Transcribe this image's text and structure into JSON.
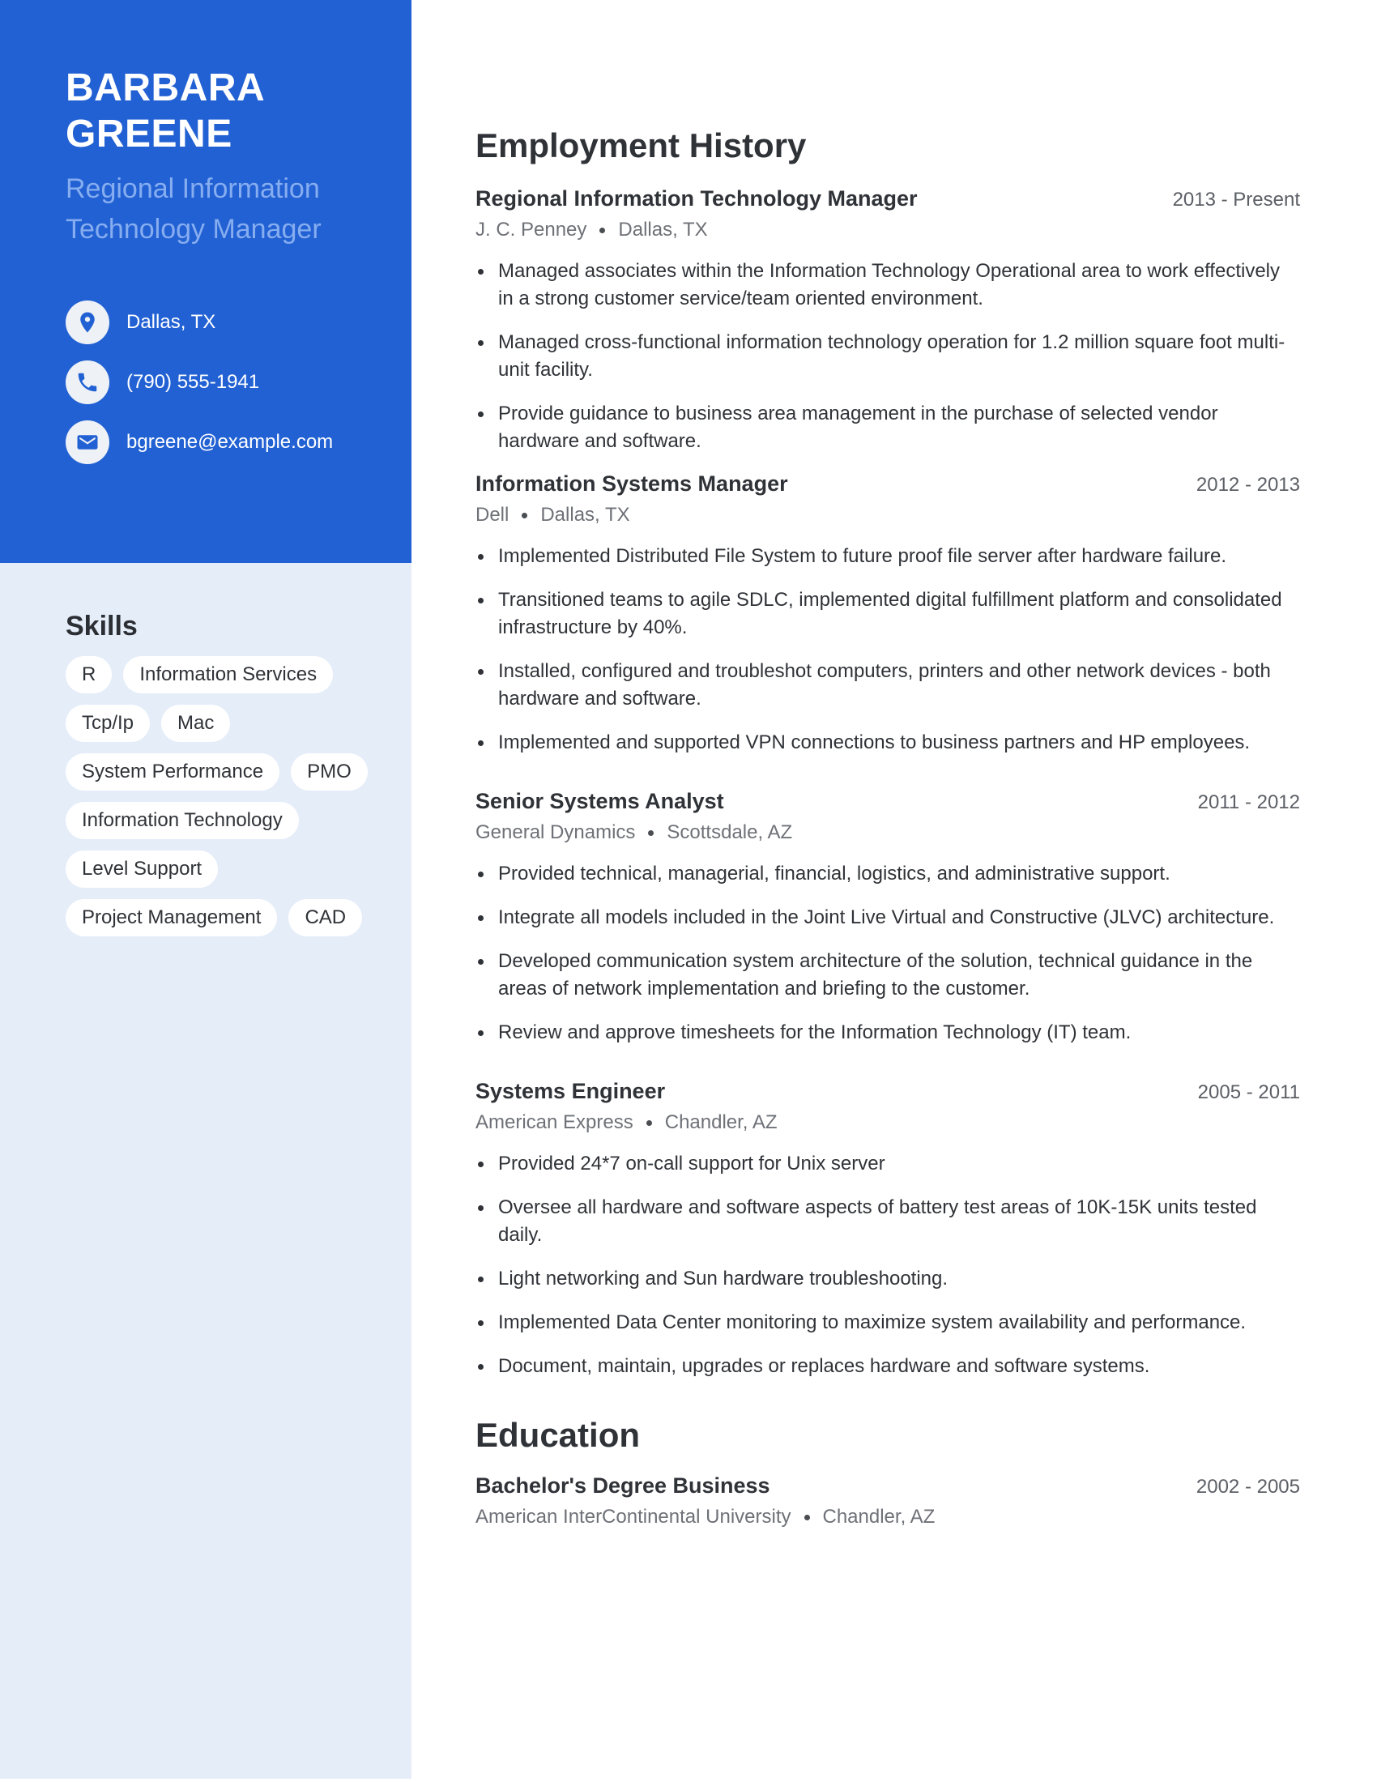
{
  "profile": {
    "name_line1": "BARBARA",
    "name_line2": "GREENE",
    "title_line1": "Regional Information",
    "title_line2": "Technology Manager"
  },
  "contacts": [
    {
      "icon": "location-pin-icon",
      "text": "Dallas, TX"
    },
    {
      "icon": "phone-icon",
      "text": "(790) 555-1941"
    },
    {
      "icon": "email-icon",
      "text": "bgreene@example.com"
    }
  ],
  "skills": {
    "title": "Skills",
    "items": [
      "R",
      "Information Services",
      "Tcp/Ip",
      "Mac",
      "System Performance",
      "PMO",
      "Information Technology",
      "Level Support",
      "Project Management",
      "CAD"
    ]
  },
  "employment": {
    "title": "Employment History",
    "jobs": [
      {
        "title": "Regional Information Technology Manager",
        "dates": "2013 - Present",
        "company": "J. C. Penney",
        "location": "Dallas, TX",
        "bullets": [
          "Managed associates within the Information Technology Operational area to work effectively in a strong customer service/team oriented environment.",
          "Managed cross-functional information technology operation for 1.2 million square foot multi-unit facility.",
          "Provide guidance to business area management in the purchase of selected vendor hardware and software."
        ]
      },
      {
        "title": "Information Systems Manager",
        "dates": "2012 - 2013",
        "company": "Dell",
        "location": "Dallas, TX",
        "bullets": [
          "Implemented Distributed File System to future proof file server after hardware failure.",
          "Transitioned teams to agile SDLC, implemented digital fulfillment platform and consolidated infrastructure by 40%.",
          "Installed, configured and troubleshot computers, printers and other network devices - both hardware and software.",
          "Implemented and supported VPN connections to business partners and HP employees."
        ]
      },
      {
        "title": "Senior Systems Analyst",
        "dates": "2011 - 2012",
        "company": "General Dynamics",
        "location": "Scottsdale, AZ",
        "bullets": [
          "Provided technical, managerial, financial, logistics, and administrative support.",
          "Integrate all models included in the Joint Live Virtual and Constructive (JLVC) architecture.",
          "Developed communication system architecture of the solution, technical guidance in the areas of network implementation and briefing to the customer.",
          "Review and approve timesheets for the Information Technology (IT) team."
        ]
      },
      {
        "title": "Systems Engineer",
        "dates": "2005 - 2011",
        "company": "American Express",
        "location": "Chandler, AZ",
        "bullets": [
          "Provided 24*7 on-call support for Unix server",
          "Oversee all hardware and software aspects of battery test areas of 10K-15K units tested daily.",
          "Light networking and Sun hardware troubleshooting.",
          "Implemented Data Center monitoring to maximize system availability and performance.",
          "Document, maintain, upgrades or replaces hardware and software systems."
        ]
      }
    ]
  },
  "education": {
    "title": "Education",
    "entries": [
      {
        "degree": "Bachelor's Degree Business",
        "dates": "2002 - 2005",
        "school": "American InterContinental University",
        "location": "Chandler, AZ"
      }
    ]
  },
  "colors": {
    "accent": "#2261d3",
    "sidebar_bg": "#e5edf9",
    "subtitle": "#86adf0",
    "text": "#2f3237"
  }
}
